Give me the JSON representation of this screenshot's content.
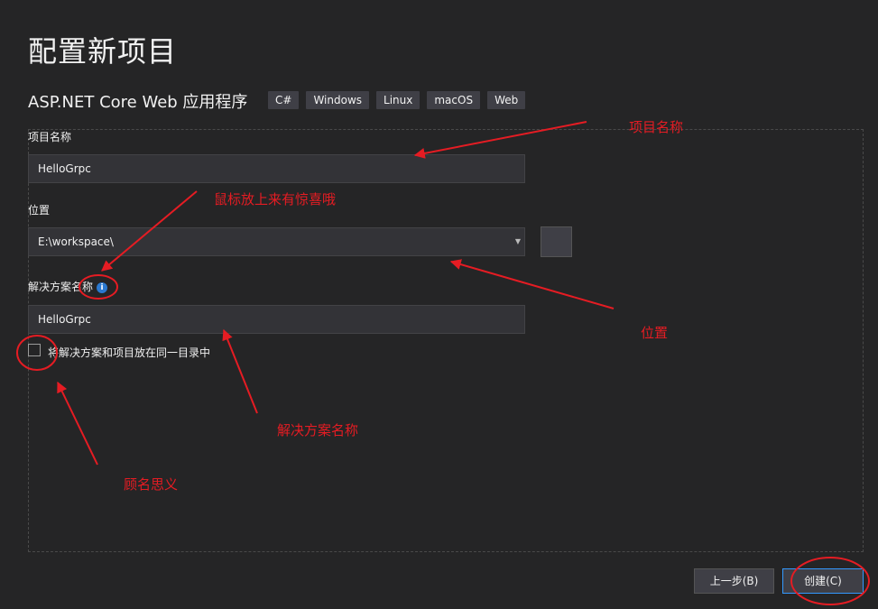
{
  "page": {
    "title": "配置新项目",
    "template_name": "ASP.NET Core Web 应用程序",
    "tags": [
      "C#",
      "Windows",
      "Linux",
      "macOS",
      "Web"
    ]
  },
  "form": {
    "project_name_label": "项目名称",
    "project_name_value": "HelloGrpc",
    "location_label": "位置",
    "location_value": "E:\\workspace\\",
    "browse_label": "...",
    "solution_name_label": "解决方案名称",
    "solution_name_value": "HelloGrpc",
    "same_dir_checkbox_label": "将解决方案和项目放在同一目录中",
    "same_dir_checked": false
  },
  "buttons": {
    "back_label": "上一步(B)",
    "create_label": "创建(C)"
  },
  "annotations": {
    "project_name": "项目名称",
    "mouse_hover": "鼠标放上来有惊喜哦",
    "location": "位置",
    "solution_name": "解决方案名称",
    "self_explanatory": "顾名思义"
  },
  "colors": {
    "background": "#252526",
    "input_bg": "#333337",
    "annotation": "#e51c23",
    "accent": "#3399ff"
  }
}
